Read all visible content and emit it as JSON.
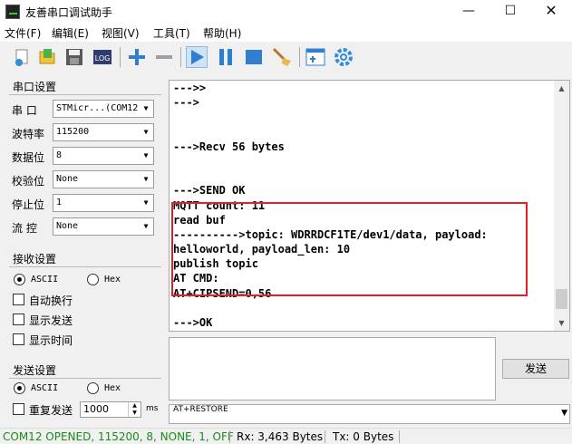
{
  "window": {
    "title": "友善串口调试助手",
    "minimize_glyph": "—",
    "maximize_glyph": "☐",
    "close_glyph": "✕"
  },
  "menu": [
    "文件(F)",
    "编辑(E)",
    "视图(V)",
    "工具(T)",
    "帮助(H)"
  ],
  "toolbar": {
    "icons": [
      "new-icon",
      "open-icon",
      "save-icon",
      "log-icon",
      "add-icon",
      "remove-icon",
      "run-icon",
      "pause-icon",
      "stop-icon",
      "clear-icon",
      "layout-icon",
      "settings-icon"
    ],
    "log_text": "LOG"
  },
  "serial_settings": {
    "title": "串口设置",
    "port": {
      "label": "串 口",
      "value": "STMicr...(COM12"
    },
    "baud": {
      "label": "波特率",
      "value": "115200"
    },
    "data_bits": {
      "label": "数据位",
      "value": "8"
    },
    "parity": {
      "label": "校验位",
      "value": "None"
    },
    "stop_bits": {
      "label": "停止位",
      "value": "1"
    },
    "flow": {
      "label": "流 控",
      "value": "None"
    }
  },
  "receive_settings": {
    "title": "接收设置",
    "ascii": "ASCII",
    "hex": "Hex",
    "selected": "ASCII",
    "auto_wrap": "自动换行",
    "show_send": "显示发送",
    "show_time": "显示时间"
  },
  "send_settings": {
    "title": "发送设置",
    "ascii": "ASCII",
    "hex": "Hex",
    "selected": "ASCII",
    "repeat": "重复发送",
    "interval": "1000",
    "unit": "ms"
  },
  "receive_text": [
    "--->>",
    "--->",
    "",
    "",
    "--->Recv 56 bytes",
    "",
    "",
    "--->SEND OK",
    "MQTT count: 11",
    "read buf",
    "---------->topic: WDRRDCF1TE/dev1/data, payload:",
    "helloworld, payload_len: 10",
    "publish topic",
    "AT CMD:",
    "AT+CIPSEND=0,56",
    "",
    "--->OK"
  ],
  "send_text": "",
  "send_button": "发送",
  "history_value": "AT+RESTORE",
  "status": {
    "port": "COM12 OPENED, 115200, 8, NONE, 1, OFF",
    "rx": "Rx: 3,463 Bytes",
    "tx": "Tx: 0 Bytes",
    "port_color": "#1a8a1a"
  },
  "highlight_color": "#e0202a"
}
